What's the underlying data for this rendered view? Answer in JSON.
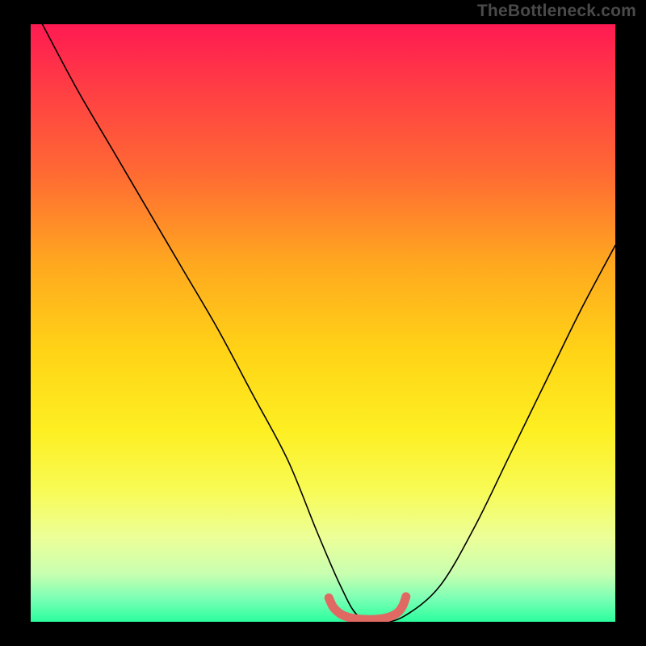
{
  "watermark": "TheBottleneck.com",
  "chart_data": {
    "type": "line",
    "title": "",
    "xlabel": "",
    "ylabel": "",
    "xlim": [
      0,
      100
    ],
    "ylim": [
      0,
      100
    ],
    "main_curve": {
      "name": "bottleneck-curve",
      "color": "#000000",
      "x": [
        2,
        8,
        14,
        20,
        26,
        32,
        38,
        44,
        49,
        53,
        56,
        60,
        64,
        70,
        76,
        82,
        88,
        94,
        100
      ],
      "y": [
        100,
        89,
        79,
        69,
        59,
        49,
        38,
        27,
        15,
        6,
        1,
        0,
        1,
        6,
        16,
        28,
        40,
        52,
        63
      ]
    },
    "highlight_segment": {
      "name": "optimal-zone",
      "color": "#e06a63",
      "x": [
        51.0,
        51.8,
        53.2,
        55.0,
        57.0,
        59.0,
        61.0,
        62.6,
        63.6,
        64.2
      ],
      "y": [
        4.0,
        2.4,
        1.2,
        0.6,
        0.4,
        0.4,
        0.7,
        1.4,
        2.6,
        4.2
      ]
    },
    "gradient_stops": [
      {
        "pos": 0,
        "color": "#ff1a52"
      },
      {
        "pos": 25,
        "color": "#ff6a33"
      },
      {
        "pos": 55,
        "color": "#ffd416"
      },
      {
        "pos": 78,
        "color": "#f8fb55"
      },
      {
        "pos": 100,
        "color": "#2bff9e"
      }
    ]
  }
}
